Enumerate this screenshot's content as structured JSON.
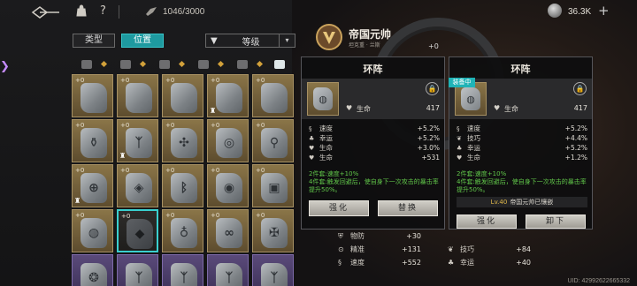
{
  "topbar": {
    "back_icon": "back-arrow-icon",
    "bag_icon": "bag-icon",
    "help_label": "?",
    "capacity": "1046/3000",
    "currency_value": "36.3K",
    "plus_label": "+"
  },
  "filter": {
    "tab_type": "类型",
    "tab_position": "位置",
    "sort_label": "等级",
    "dropdown_icon": "chevron-down-icon"
  },
  "grid": {
    "rows": [
      [
        {
          "lv": "+0",
          "glyph": "",
          "lock": false
        },
        {
          "lv": "+0",
          "glyph": "",
          "lock": false
        },
        {
          "lv": "+0",
          "glyph": "",
          "lock": false
        },
        {
          "lv": "+0",
          "glyph": "",
          "lock": true
        },
        {
          "lv": "+0",
          "glyph": "",
          "lock": false
        }
      ],
      [
        {
          "lv": "+0",
          "glyph": "⚱",
          "lock": false
        },
        {
          "lv": "+0",
          "glyph": "ᛉ",
          "lock": true
        },
        {
          "lv": "+0",
          "glyph": "✣",
          "lock": false
        },
        {
          "lv": "+0",
          "glyph": "◎",
          "lock": false
        },
        {
          "lv": "+0",
          "glyph": "⚲",
          "lock": false
        }
      ],
      [
        {
          "lv": "+0",
          "glyph": "⊕",
          "lock": true
        },
        {
          "lv": "+0",
          "glyph": "◈",
          "lock": false
        },
        {
          "lv": "+0",
          "glyph": "ᛒ",
          "lock": false
        },
        {
          "lv": "+0",
          "glyph": "◉",
          "lock": false
        },
        {
          "lv": "+0",
          "glyph": "▣",
          "lock": false
        }
      ],
      [
        {
          "lv": "+0",
          "glyph": "◍",
          "lock": false
        },
        {
          "lv": "+0",
          "glyph": "◆",
          "lock": false,
          "selected": true
        },
        {
          "lv": "+0",
          "glyph": "♁",
          "lock": false
        },
        {
          "lv": "+0",
          "glyph": "∞",
          "lock": false
        },
        {
          "lv": "+0",
          "glyph": "✠",
          "lock": false
        }
      ],
      [
        {
          "lv": "",
          "glyph": "❂",
          "lock": false,
          "purple": true
        },
        {
          "lv": "",
          "glyph": "ᛉ",
          "lock": false,
          "purple": true
        },
        {
          "lv": "",
          "glyph": "ᛉ",
          "lock": false,
          "purple": true
        },
        {
          "lv": "",
          "glyph": "ᛉ",
          "lock": false,
          "purple": true
        },
        {
          "lv": "",
          "glyph": "ᛉ",
          "lock": false,
          "purple": true
        }
      ]
    ]
  },
  "character": {
    "name": "帝国元帅",
    "subtitle": "坦克重 · 兰斯",
    "wheel_level": "+0"
  },
  "left_panel": {
    "title": "环阵",
    "main_attr_name": "生命",
    "main_attr_value": "417",
    "subs": [
      {
        "icon": "§",
        "name": "速度",
        "value": "+5.2%"
      },
      {
        "icon": "♣",
        "name": "幸运",
        "value": "+5.2%"
      },
      {
        "icon": "♥",
        "name": "生命",
        "value": "+3.0%"
      },
      {
        "icon": "♥",
        "name": "生命",
        "value": "+531"
      }
    ],
    "set_2": "2件套:速度+10%",
    "set_4": "4件套:触发回避后，使自身下一次攻击的暴击率提升50%。",
    "btn_enhance": "强化",
    "btn_replace": "替换"
  },
  "right_panel": {
    "title": "环阵",
    "tag": "装备中",
    "main_attr_name": "生命",
    "main_attr_value": "417",
    "subs": [
      {
        "icon": "§",
        "name": "速度",
        "value": "+5.2%"
      },
      {
        "icon": "❦",
        "name": "技巧",
        "value": "+4.4%"
      },
      {
        "icon": "♣",
        "name": "幸运",
        "value": "+5.2%"
      },
      {
        "icon": "♥",
        "name": "生命",
        "value": "+1.2%"
      }
    ],
    "set_2": "2件套:速度+10%",
    "set_4": "4件套:触发回避后，使自身下一次攻击的暴击率提升50%。",
    "equipped_level": "Lv.40",
    "equipped_text": "帝国元帅已镶嵌",
    "btn_enhance": "强化",
    "btn_unequip": "卸下"
  },
  "stats": [
    {
      "icon": "⛨",
      "name": "物防",
      "value": "+30"
    },
    {
      "icon": "⊙",
      "name": "精准",
      "value": "+131"
    },
    {
      "icon": "§",
      "name": "速度",
      "value": "+552"
    },
    {
      "icon": "❦",
      "name": "技巧",
      "value": "+84"
    },
    {
      "icon": "♣",
      "name": "幸运",
      "value": "+40"
    }
  ],
  "uid": "UID: 42992622665332"
}
